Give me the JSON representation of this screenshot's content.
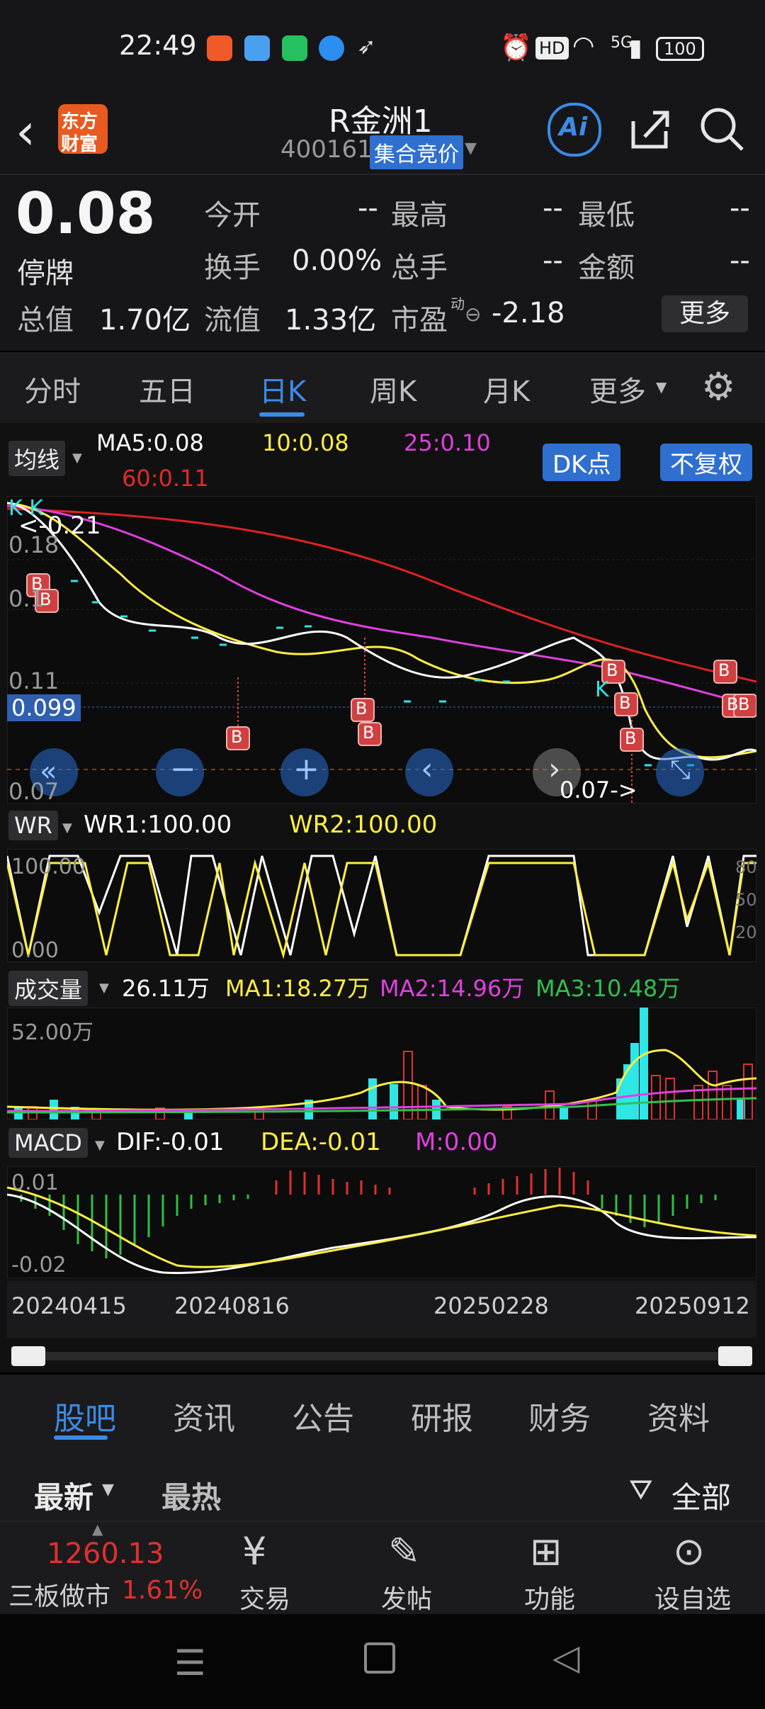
{
  "status": {
    "time": "22:49",
    "battery": "100",
    "network": "5G",
    "hd": "HD"
  },
  "header": {
    "logo_line1": "东方",
    "logo_line2": "财富",
    "stock_name": "R金洲1",
    "stock_code": "400161",
    "auction_badge": "集合竞价",
    "ai_label": "Ai"
  },
  "quote": {
    "price": "0.08",
    "status": "停牌",
    "open_label": "今开",
    "open_value": "--",
    "high_label": "最高",
    "high_value": "--",
    "low_label": "最低",
    "low_value": "--",
    "turnover_label": "换手",
    "turnover_value": "0.00%",
    "volume_label": "总手",
    "volume_value": "--",
    "amount_label": "金额",
    "amount_value": "--",
    "mktcap_label": "总值",
    "mktcap_value": "1.70亿",
    "float_label": "流值",
    "float_value": "1.33亿",
    "pe_label": "市盈",
    "pe_sup": "动",
    "pe_value": "-2.18",
    "more_button": "更多"
  },
  "period_tabs": {
    "items": [
      "分时",
      "五日",
      "日K",
      "周K",
      "月K",
      "更多"
    ],
    "active": "日K"
  },
  "ma": {
    "selector": "均线",
    "ma5": "MA5:0.08",
    "ma10": "10:0.08",
    "ma25": "25:0.10",
    "ma60": "60:0.11",
    "dk_button": "DK点",
    "fq_button": "不复权"
  },
  "kline": {
    "y_labels": [
      "0.18",
      "0.1",
      "0.11",
      "0.07"
    ],
    "current_price": "0.099",
    "annotation_high": "<-0.21",
    "annotation_low": "0.07->",
    "kk_label": "K K",
    "k_label": "K",
    "b_markers": [
      "B",
      "B",
      "B",
      "B",
      "B",
      "B",
      "B",
      "B",
      "B",
      "B",
      "B"
    ]
  },
  "wr": {
    "selector": "WR",
    "wr1": "WR1:100.00",
    "wr2": "WR2:100.00",
    "y_top": "100.00",
    "y_bottom": "0.00",
    "right_labels": [
      "80",
      "50",
      "20"
    ]
  },
  "volume": {
    "selector": "成交量",
    "current": "26.11万",
    "ma1": "MA1:18.27万",
    "ma2": "MA2:14.96万",
    "ma3": "MA3:10.48万",
    "y_top": "52.00万"
  },
  "macd": {
    "selector": "MACD",
    "dif": "DIF:-0.01",
    "dea": "DEA:-0.01",
    "m": "M:0.00",
    "y_top": "0.01",
    "y_bottom": "-0.02"
  },
  "dates": [
    "20240415",
    "20240816",
    "20250228",
    "20250912"
  ],
  "biz_tabs": {
    "items": [
      "股吧",
      "资讯",
      "公告",
      "研报",
      "财务",
      "资料"
    ],
    "active": "股吧"
  },
  "filter": {
    "latest": "最新",
    "hot": "最热",
    "all": "全部"
  },
  "bottom": {
    "index_value": "1260.13",
    "index_name": "三板做市",
    "index_change": "1.61%",
    "trade": "交易",
    "post": "发帖",
    "func": "功能",
    "watch": "设自选"
  },
  "colors": {
    "ma5": "#ffffff",
    "ma10": "#ffee44",
    "ma25": "#e040e0",
    "ma60": "#dd2222",
    "up": "#e03030",
    "down": "#2ee6e6",
    "accent": "#3b8be8"
  }
}
